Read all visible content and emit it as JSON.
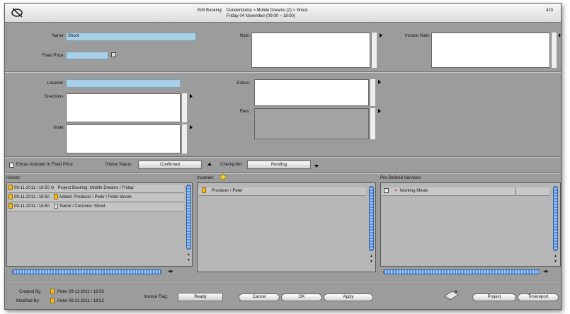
{
  "title": {
    "prefix": "Edit Booking:",
    "path": "Dunderklump > Mobile Dreams (2) > Shoot",
    "datetime": "Friday 04 November (09:00 ~ 18:00)",
    "number": "423"
  },
  "form": {
    "name_label": "Name:",
    "name_value": "Shoot",
    "fixed_price_label": "Fixed Price:",
    "fixed_price_value": "",
    "note_label": "Note:",
    "invoice_note_label": "Invoice Note:",
    "location_label": "Location:",
    "location_value": "",
    "directions_label": "Directions:",
    "hotel_label": "Hotel:",
    "extras_label": "Extras:",
    "files_label": "Files:"
  },
  "status": {
    "extras_included_label": "Extras Included In Fixed Price",
    "global_status_label": "Global Status:",
    "global_status_value": "Confirmed",
    "checkpoint_label": "Checkpoint:",
    "checkpoint_value": "Pending"
  },
  "history": {
    "title": "History:",
    "rows": [
      {
        "date": "09-11-2011 / 18:50",
        "text": "Project Booking: Mobile Dreams / Friday"
      },
      {
        "date": "09-11-2011 / 18:50",
        "text": "Added: Producer / Peter / Peter Moore"
      },
      {
        "date": "09-11-2011 / 18:50",
        "text": "Name / Custome: Shoot"
      }
    ]
  },
  "involved": {
    "title": "Involved:",
    "rows": [
      {
        "text": "Producer / Peter"
      }
    ]
  },
  "services": {
    "title": "Pre-Defined Services:",
    "rows": [
      {
        "text": "Working Meals"
      }
    ]
  },
  "footer": {
    "created_label": "Created By:",
    "created_value": "Peter 09-11-2011 / 18:50",
    "modified_label": "Modified By:",
    "modified_value": "Peter 09-11-2011 / 18:52",
    "invoice_flag_label": "Invoice Flag:",
    "invoice_flag_value": "Ready",
    "cancel_label": "Cancel",
    "ok_label": "OK",
    "apply_label": "Apply",
    "project_label": "Project",
    "timereport_label": "Timereport"
  },
  "colors": {
    "field_blue": "#a9cfe6",
    "window_grey": "#9c9c9c",
    "scroll_blue": "#5a8fd8",
    "icon_yellow": "#f2b823"
  }
}
